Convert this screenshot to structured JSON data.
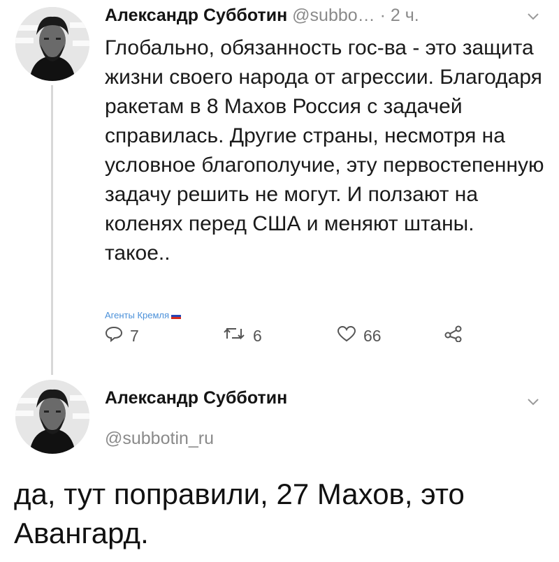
{
  "tweet1": {
    "author_name": "Александр Субботин",
    "handle": "@subbo…",
    "time": "· 2 ч.",
    "text": "Глобально, обязанность гос-ва - это защита жизни своего народа от агрессии. Благодаря ракетам в 8 Махов Россия с задачей справилась. Другие страны, несмотря на условное благополучие, эту первостепенную задачу решить не могут. И ползают на коленях перед США и меняют штаны. такое..",
    "sticker": "Агенты Кремля",
    "replies": "7",
    "retweets": "6",
    "likes": "66"
  },
  "tweet2": {
    "author_name": "Александр Субботин",
    "handle": "@subbotin_ru",
    "text": "да, тут поправили, 27 Махов, это Авангард."
  },
  "icons": {
    "menu": "chevron-down-icon",
    "reply": "reply-icon",
    "retweet": "retweet-icon",
    "like": "heart-icon",
    "share": "share-icon"
  },
  "colors": {
    "handle_gray": "#8a8a8a",
    "sticker_blue": "#4a90d9"
  }
}
